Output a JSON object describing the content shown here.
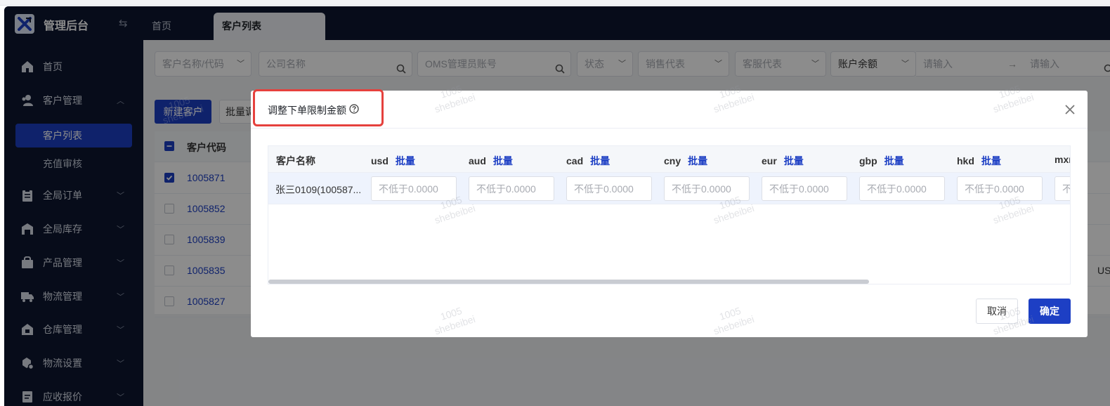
{
  "app": {
    "name": "管理后台",
    "tabs": [
      {
        "label": "首页",
        "active": false
      },
      {
        "label": "客户列表",
        "active": true
      }
    ]
  },
  "sidebar": {
    "items": [
      {
        "label": "首页",
        "icon": "home-icon"
      },
      {
        "label": "客户管理",
        "icon": "users-icon",
        "expanded": true,
        "children": [
          {
            "label": "客户列表",
            "active": true
          },
          {
            "label": "充值审核",
            "active": false
          }
        ]
      },
      {
        "label": "全局订单",
        "icon": "clipboard-icon"
      },
      {
        "label": "全局库存",
        "icon": "warehouse-icon"
      },
      {
        "label": "产品管理",
        "icon": "bag-icon"
      },
      {
        "label": "物流管理",
        "icon": "truck-icon"
      },
      {
        "label": "仓库管理",
        "icon": "building-icon"
      },
      {
        "label": "物流设置",
        "icon": "gear-box-icon"
      },
      {
        "label": "应收报价",
        "icon": "document-icon"
      }
    ]
  },
  "filters": {
    "customer_name_code": "客户名称/代码",
    "company_name": "公司名称",
    "oms_admin": "OMS管理员账号",
    "status": "状态",
    "sales_rep": "销售代表",
    "service_rep": "客服代表",
    "balance_select": "账户余额",
    "range_from": "请输入",
    "range_to": "请输入"
  },
  "toolbar": {
    "new_customer": "新建客户",
    "batch": "批量调"
  },
  "table": {
    "header_code": "客户代码",
    "rows": [
      {
        "code": "1005871",
        "checked": true
      },
      {
        "code": "1005852",
        "checked": false
      },
      {
        "code": "1005839",
        "checked": false
      },
      {
        "code": "1005835",
        "checked": false
      },
      {
        "code": "1005827",
        "checked": false
      }
    ],
    "edge_text": "US"
  },
  "modal": {
    "title": "调整下单限制金额",
    "help_icon": "question-circle-icon",
    "grid": {
      "name_header": "客户名称",
      "batch_label": "批量",
      "currencies": [
        "usd",
        "aud",
        "cad",
        "cny",
        "eur",
        "gbp",
        "hkd",
        "mxn"
      ],
      "row_name": "张三0109(100587...",
      "input_placeholder": "不低于0.0000"
    },
    "cancel": "取消",
    "confirm": "确定"
  },
  "watermark": {
    "line1": "1005",
    "line2": "shebeibei"
  },
  "colors": {
    "primary": "#1d3fc4",
    "sidebar_bg": "#0d1730",
    "highlight": "#e5413d"
  }
}
